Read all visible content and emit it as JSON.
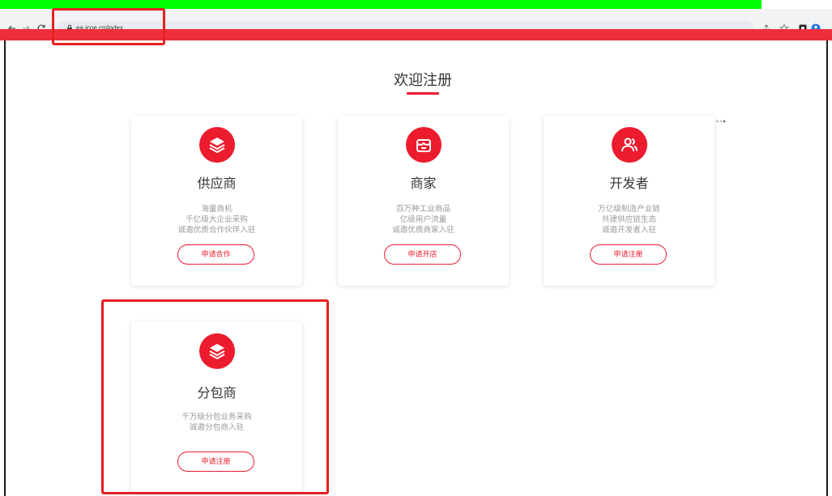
{
  "colors": {
    "accent": "#ec1c2e",
    "annotation": "#e62020",
    "highlight_band": "#00ff00"
  },
  "browser": {
    "url": "ea.icoe.cn/index",
    "icons": [
      "back-icon",
      "forward-icon",
      "reload-icon",
      "lock-icon",
      "share-icon",
      "star-icon",
      "extension-icon",
      "profile-icon"
    ]
  },
  "page": {
    "title": "欢迎注册"
  },
  "cards": [
    {
      "icon": "layers-icon",
      "title": "供应商",
      "lines": [
        "海量商机",
        "千亿级大企业采购",
        "诚邀优质合作伙伴入驻"
      ],
      "button": "申请合作"
    },
    {
      "icon": "store-icon",
      "title": "商家",
      "lines": [
        "百万种工业商品",
        "亿级用户流量",
        "诚邀优质商家入驻"
      ],
      "button": "申请开店"
    },
    {
      "icon": "users-icon",
      "title": "开发者",
      "lines": [
        "万亿级制造产业链",
        "共建供应链生态",
        "诚邀开发者入驻"
      ],
      "button": "申请注册"
    },
    {
      "icon": "layers-icon",
      "title": "分包商",
      "lines": [
        "千万级分包业务采购",
        "诚邀分包商入驻"
      ],
      "button": "申请注册"
    }
  ]
}
